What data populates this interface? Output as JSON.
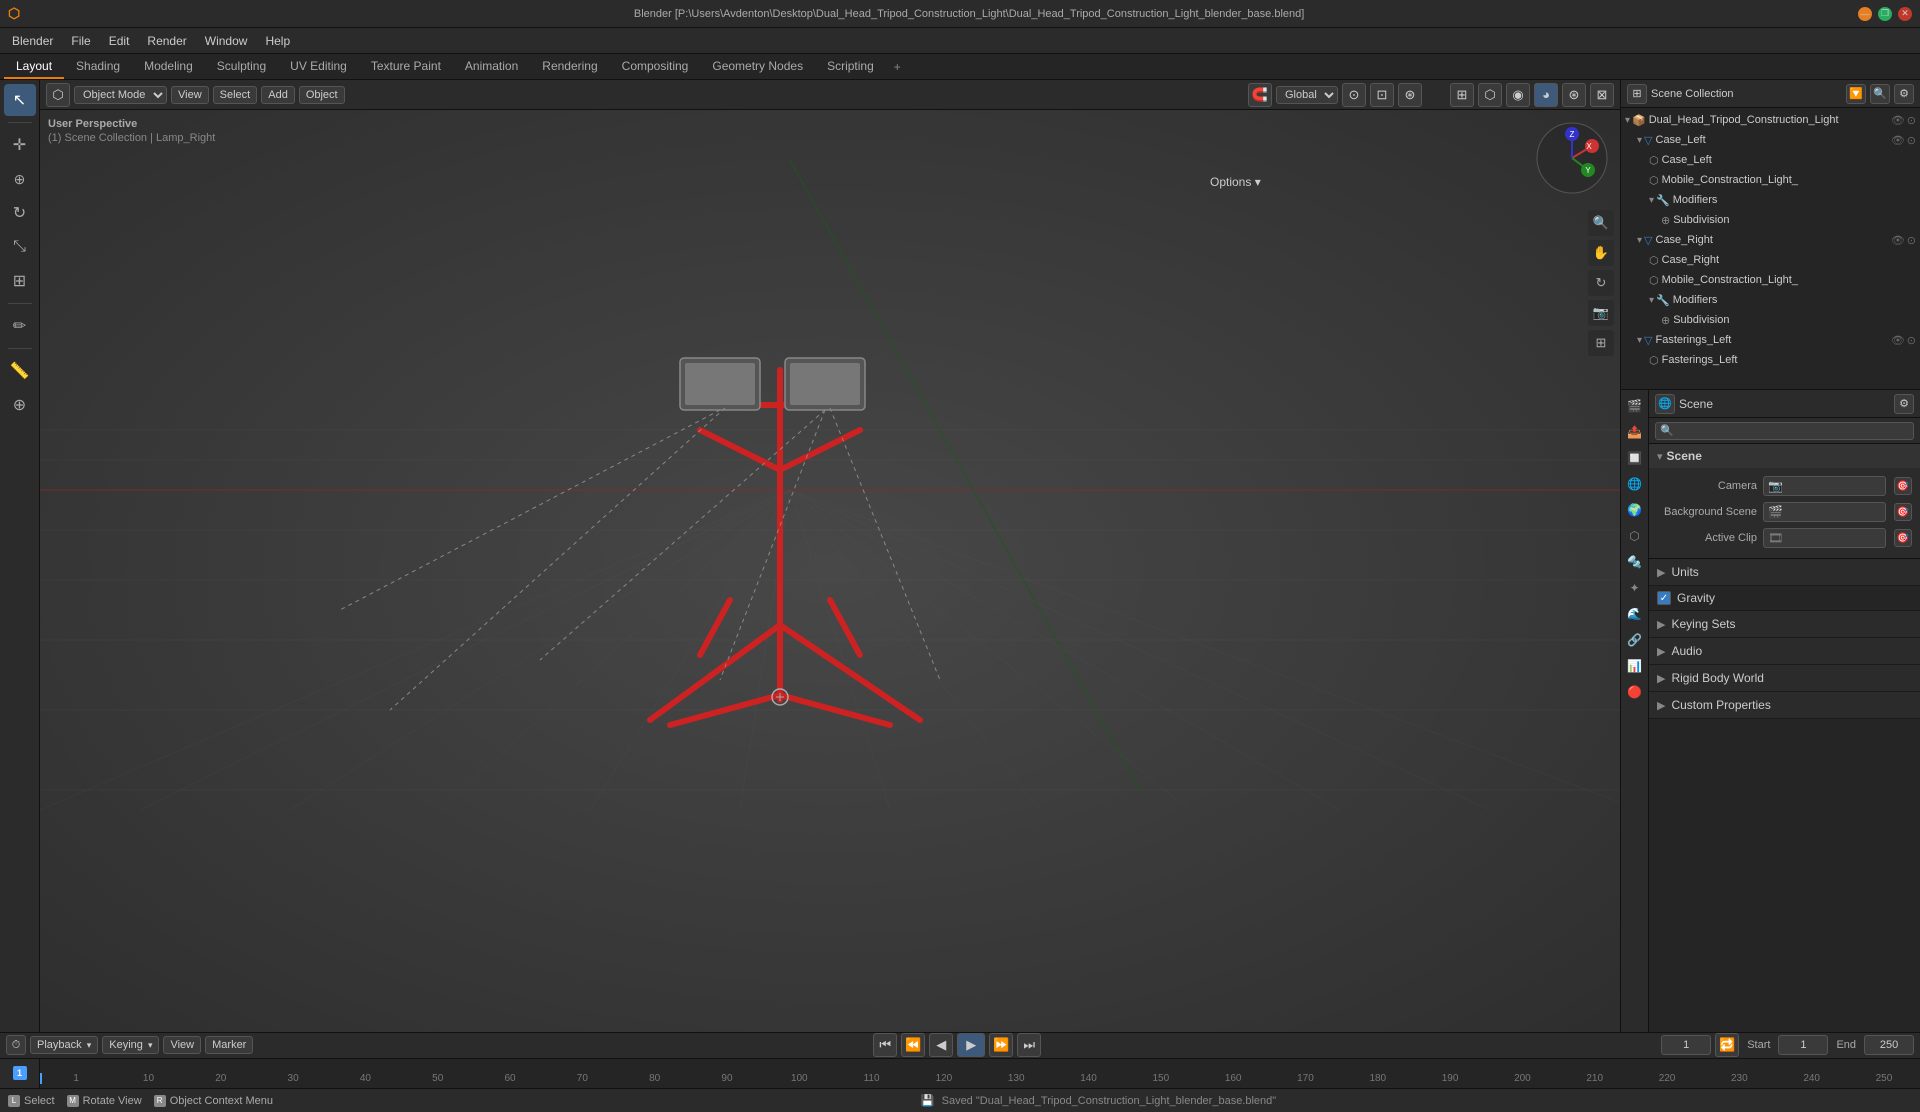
{
  "titlebar": {
    "title": "Blender [P:\\Users\\Avdenton\\Desktop\\Dual_Head_Tripod_Construction_Light\\Dual_Head_Tripod_Construction_Light_blender_base.blend]",
    "close": "✕",
    "minimize": "—",
    "maximize": "❐"
  },
  "menubar": {
    "logo": "⬡",
    "items": [
      "Blender",
      "File",
      "Edit",
      "Render",
      "Window",
      "Help"
    ]
  },
  "workspace_tabs": {
    "tabs": [
      "Layout",
      "Shading",
      "Modeling",
      "Sculpting",
      "UV Editing",
      "Texture Paint",
      "Animation",
      "Rendering",
      "Compositing",
      "Geometry Nodes",
      "Scripting"
    ],
    "active": "Layout",
    "add": "+"
  },
  "viewport": {
    "mode": "Object Mode",
    "view": "Global",
    "overlay_label": "User Perspective",
    "collection_label": "(1) Scene Collection | Lamp_Right",
    "header_items": [
      "Object Mode",
      "View",
      "Select",
      "Add",
      "Object"
    ]
  },
  "left_tools": {
    "tools": [
      "↖",
      "↔",
      "↻",
      "⊡",
      "⬡",
      "✏",
      "✂",
      "⊕"
    ]
  },
  "outliner": {
    "title": "Scene Collection",
    "search_placeholder": "🔍",
    "items": [
      {
        "label": "Dual_Head_Tripod_Construction_Light",
        "depth": 0,
        "has_arrow": true,
        "icon": "📦",
        "visible": true,
        "selected": false
      },
      {
        "label": "Case_Left",
        "depth": 1,
        "has_arrow": true,
        "icon": "▽",
        "visible": true,
        "selected": false
      },
      {
        "label": "Case_Left",
        "depth": 2,
        "has_arrow": false,
        "icon": "⬡",
        "visible": false,
        "selected": false
      },
      {
        "label": "Mobile_Constraction_Light_",
        "depth": 2,
        "has_arrow": false,
        "icon": "⬡",
        "visible": false,
        "selected": false
      },
      {
        "label": "Modifiers",
        "depth": 2,
        "has_arrow": true,
        "icon": "🔧",
        "visible": false,
        "selected": false
      },
      {
        "label": "Subdivision",
        "depth": 3,
        "has_arrow": false,
        "icon": "⊕",
        "visible": false,
        "selected": false
      },
      {
        "label": "Case_Right",
        "depth": 1,
        "has_arrow": true,
        "icon": "▽",
        "visible": true,
        "selected": false
      },
      {
        "label": "Case_Right",
        "depth": 2,
        "has_arrow": false,
        "icon": "⬡",
        "visible": false,
        "selected": false
      },
      {
        "label": "Mobile_Constraction_Light_",
        "depth": 2,
        "has_arrow": false,
        "icon": "⬡",
        "visible": false,
        "selected": false
      },
      {
        "label": "Modifiers",
        "depth": 2,
        "has_arrow": true,
        "icon": "🔧",
        "visible": false,
        "selected": false
      },
      {
        "label": "Subdivision",
        "depth": 3,
        "has_arrow": false,
        "icon": "⊕",
        "visible": false,
        "selected": false
      },
      {
        "label": "Fasterings_Left",
        "depth": 1,
        "has_arrow": true,
        "icon": "▽",
        "visible": true,
        "selected": false
      },
      {
        "label": "Fasterings_Left",
        "depth": 2,
        "has_arrow": false,
        "icon": "⬡",
        "visible": false,
        "selected": false
      }
    ]
  },
  "properties": {
    "tabs": [
      "🎬",
      "🎨",
      "📷",
      "🌐",
      "⚙",
      "🔩",
      "✦",
      "🌟",
      "💡",
      "🎭",
      "🔴",
      "🔲"
    ],
    "active_tab": "🌐",
    "scene_label": "Scene",
    "sections": {
      "scene": {
        "title": "Scene",
        "camera_label": "Camera",
        "camera_value": "",
        "background_scene_label": "Background Scene",
        "background_scene_value": "",
        "active_clip_label": "Active Clip",
        "active_clip_value": ""
      },
      "units": {
        "title": "Units",
        "collapsed": true
      },
      "gravity": {
        "title": "Gravity",
        "checked": true
      },
      "keying_sets": {
        "title": "Keying Sets",
        "collapsed": true
      },
      "audio": {
        "title": "Audio",
        "collapsed": true
      },
      "rigid_body_world": {
        "title": "Rigid Body World",
        "collapsed": true
      },
      "custom_properties": {
        "title": "Custom Properties",
        "collapsed": true
      }
    }
  },
  "timeline": {
    "playback_label": "Playback",
    "keying_label": "Keying",
    "view_label": "View",
    "marker_label": "Marker",
    "start_label": "Start",
    "start_value": "1",
    "end_label": "End",
    "end_value": "250",
    "current_frame": "1",
    "ruler_marks": [
      "1",
      "10",
      "20",
      "30",
      "40",
      "50",
      "60",
      "70",
      "80",
      "90",
      "100",
      "110",
      "120",
      "130",
      "140",
      "150",
      "160",
      "170",
      "180",
      "190",
      "200",
      "210",
      "220",
      "230",
      "240",
      "250"
    ]
  },
  "statusbar": {
    "select_label": "Select",
    "rotate_label": "Rotate View",
    "context_label": "Object Context Menu",
    "saved_msg": "Saved \"Dual_Head_Tripod_Construction_Light_blender_base.blend\""
  },
  "colors": {
    "accent": "#e87d0d",
    "active_blue": "#3d5a7a",
    "tripod_red": "#cc2222",
    "grid_line": "#3a3a3a",
    "bg_dark": "#2b2b2b",
    "bg_darker": "#252525"
  }
}
